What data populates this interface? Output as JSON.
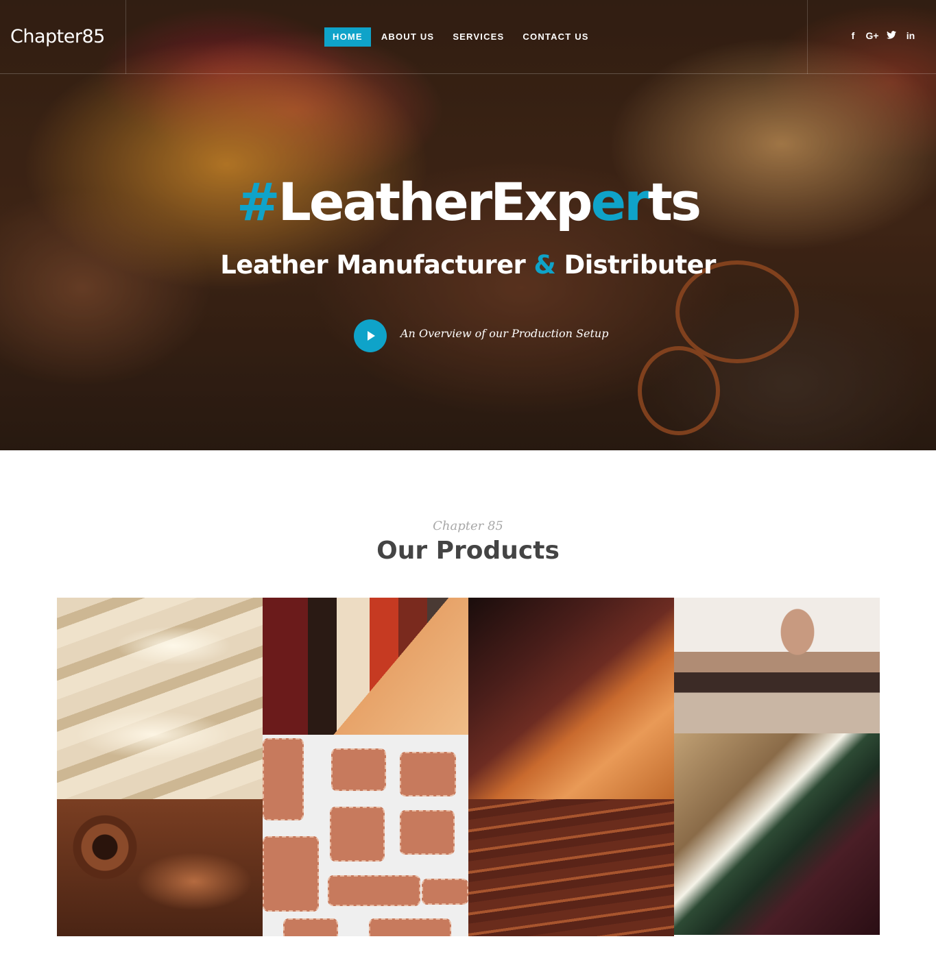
{
  "brand": {
    "logo": "Chapter85",
    "accent_color": "#0fa3c9"
  },
  "nav": {
    "items": [
      {
        "label": "HOME",
        "active": true
      },
      {
        "label": "ABOUT US",
        "active": false
      },
      {
        "label": "SERVICES",
        "active": false
      },
      {
        "label": "CONTACT US",
        "active": false
      }
    ]
  },
  "social": [
    {
      "icon": "facebook-icon",
      "glyph": "f"
    },
    {
      "icon": "google-plus-icon",
      "glyph": "G+"
    },
    {
      "icon": "twitter-icon",
      "glyph": "🐦"
    },
    {
      "icon": "linkedin-icon",
      "glyph": "in"
    }
  ],
  "hero": {
    "title_hash": "#",
    "title_part1": "LeatherExp",
    "title_accent": "er",
    "title_part2": "ts",
    "subtitle_part1": "Leather Manufacturer ",
    "subtitle_amp": "&",
    "subtitle_part2": " Distributer",
    "video_caption": "An Overview of our Production Setup"
  },
  "products": {
    "kicker": "Chapter 85",
    "title": "Our Products",
    "images": [
      "cream-leather-image",
      "leather-rolls-image",
      "dark-leather-image",
      "leather-shop-image",
      "rolled-hides-image",
      "leather-patches-image",
      "stacked-leather-image",
      "green-leather-image"
    ]
  }
}
